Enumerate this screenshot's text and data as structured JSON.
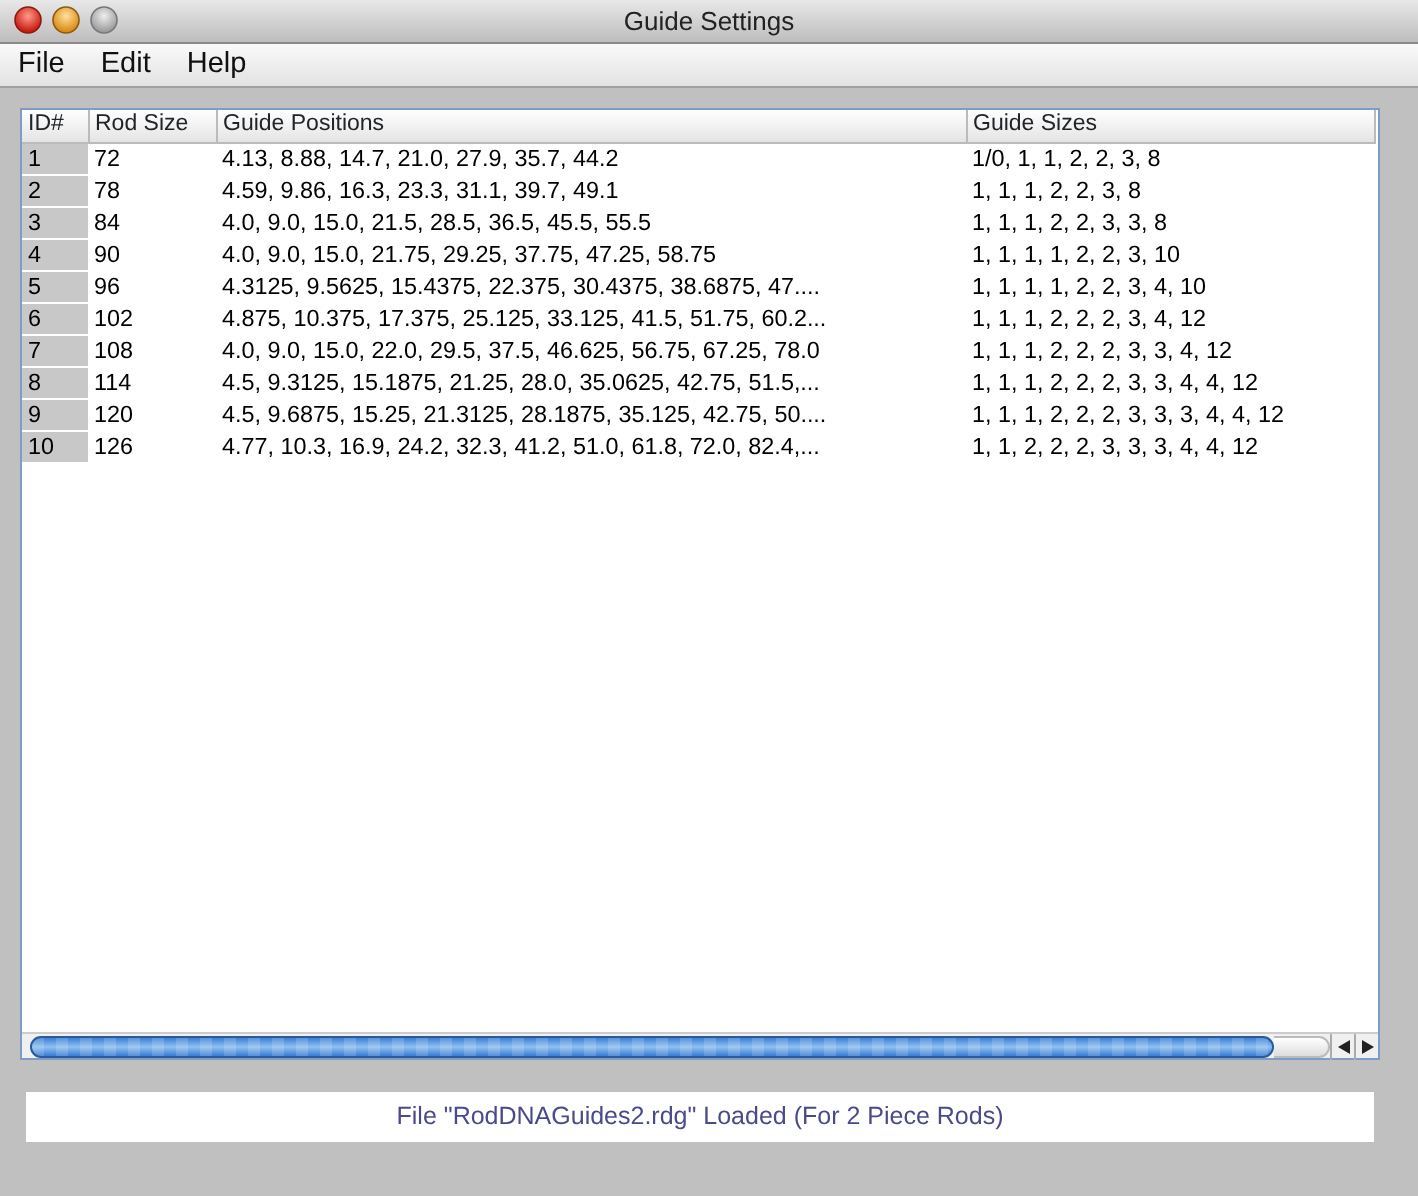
{
  "window": {
    "title": "Guide Settings"
  },
  "menu": [
    "File",
    "Edit",
    "Help"
  ],
  "table": {
    "columns": [
      "ID#",
      "Rod Size",
      "Guide Positions",
      "Guide Sizes"
    ],
    "rows": [
      [
        "1",
        "72",
        "4.13, 8.88, 14.7, 21.0, 27.9, 35.7, 44.2",
        "1/0, 1, 1, 2, 2, 3, 8"
      ],
      [
        "2",
        "78",
        "4.59, 9.86, 16.3, 23.3, 31.1, 39.7, 49.1",
        "1, 1, 1, 2, 2, 3, 8"
      ],
      [
        "3",
        "84",
        "4.0, 9.0, 15.0, 21.5, 28.5, 36.5, 45.5, 55.5",
        "1, 1, 1, 2, 2, 3, 3, 8"
      ],
      [
        "4",
        "90",
        "4.0, 9.0, 15.0, 21.75, 29.25, 37.75, 47.25, 58.75",
        "1, 1, 1, 1, 2, 2, 3, 10"
      ],
      [
        "5",
        "96",
        "4.3125, 9.5625, 15.4375, 22.375, 30.4375, 38.6875, 47....",
        "1, 1, 1, 1, 2, 2, 3, 4, 10"
      ],
      [
        "6",
        "102",
        "4.875, 10.375, 17.375, 25.125, 33.125, 41.5, 51.75, 60.2...",
        "1, 1, 1, 2, 2, 2, 3, 4, 12"
      ],
      [
        "7",
        "108",
        "4.0, 9.0, 15.0, 22.0, 29.5, 37.5, 46.625, 56.75, 67.25, 78.0",
        "1, 1, 1, 2, 2, 2, 3, 3, 4, 12"
      ],
      [
        "8",
        "114",
        "4.5, 9.3125, 15.1875, 21.25, 28.0, 35.0625, 42.75, 51.5,...",
        "1, 1, 1, 2, 2, 2, 3, 3, 4, 4, 12"
      ],
      [
        "9",
        "120",
        "4.5, 9.6875, 15.25, 21.3125, 28.1875, 35.125, 42.75, 50....",
        "1, 1, 1, 2, 2, 2, 3, 3, 3, 4, 4, 12"
      ],
      [
        "10",
        "126",
        "4.77, 10.3, 16.9, 24.2, 32.3, 41.2, 51.0, 61.8, 72.0, 82.4,...",
        "1, 1, 2, 2, 2, 3, 3, 3, 4, 4, 12"
      ]
    ]
  },
  "status_bar": "File \"RodDNAGuides2.rdg\" Loaded (For 2 Piece Rods)"
}
